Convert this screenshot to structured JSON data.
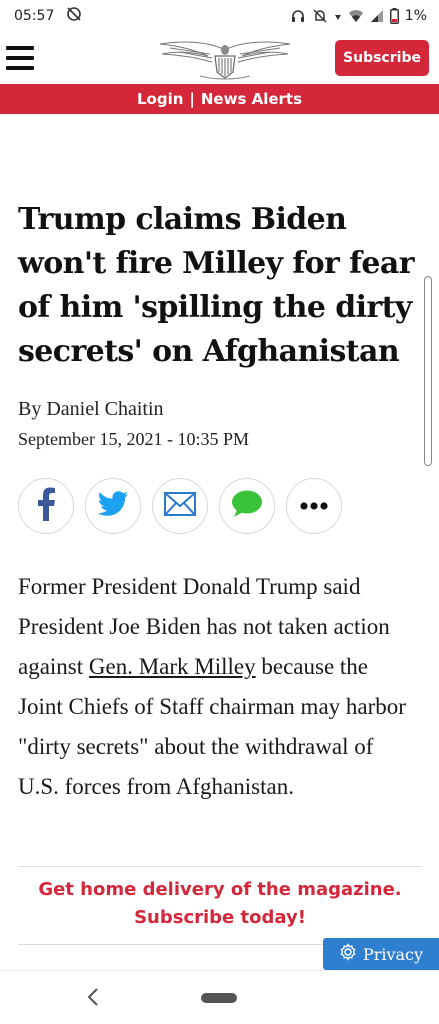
{
  "status_bar": {
    "time": "05:57",
    "battery": "1%"
  },
  "header": {
    "logo": "eagle-logo",
    "subscribe_label": "Subscribe"
  },
  "login_bar": {
    "login_label": "Login",
    "separator": "|",
    "alerts_label": "News Alerts"
  },
  "article": {
    "headline": "Trump claims Biden won't fire Milley for fear of him 'spilling the dirty secrets' on Afghanistan",
    "byline": "By Daniel Chaitin",
    "date": "September 15, 2021 - 10:35 PM",
    "body_part1": "Former President Donald Trump said President Joe Biden has not taken action against ",
    "body_link": "Gen. Mark Milley",
    "body_part2": " because the Joint Chiefs of Staff chairman may harbor \"dirty secrets\" about the withdrawal of U.S. forces from Afghanistan."
  },
  "share_buttons": [
    "facebook-icon",
    "twitter-icon",
    "email-icon",
    "message-icon",
    "more-icon"
  ],
  "promo": {
    "line1": "Get home delivery of the magazine.",
    "line2": "Subscribe today!"
  },
  "privacy": {
    "label": "Privacy"
  },
  "colors": {
    "brand_red": "#d4283a",
    "facebook_blue": "#3b5998",
    "twitter_blue": "#1da1f2",
    "email_blue": "#2a7bd0",
    "message_green": "#3ac33a",
    "privacy_blue": "#2f7fd0"
  }
}
